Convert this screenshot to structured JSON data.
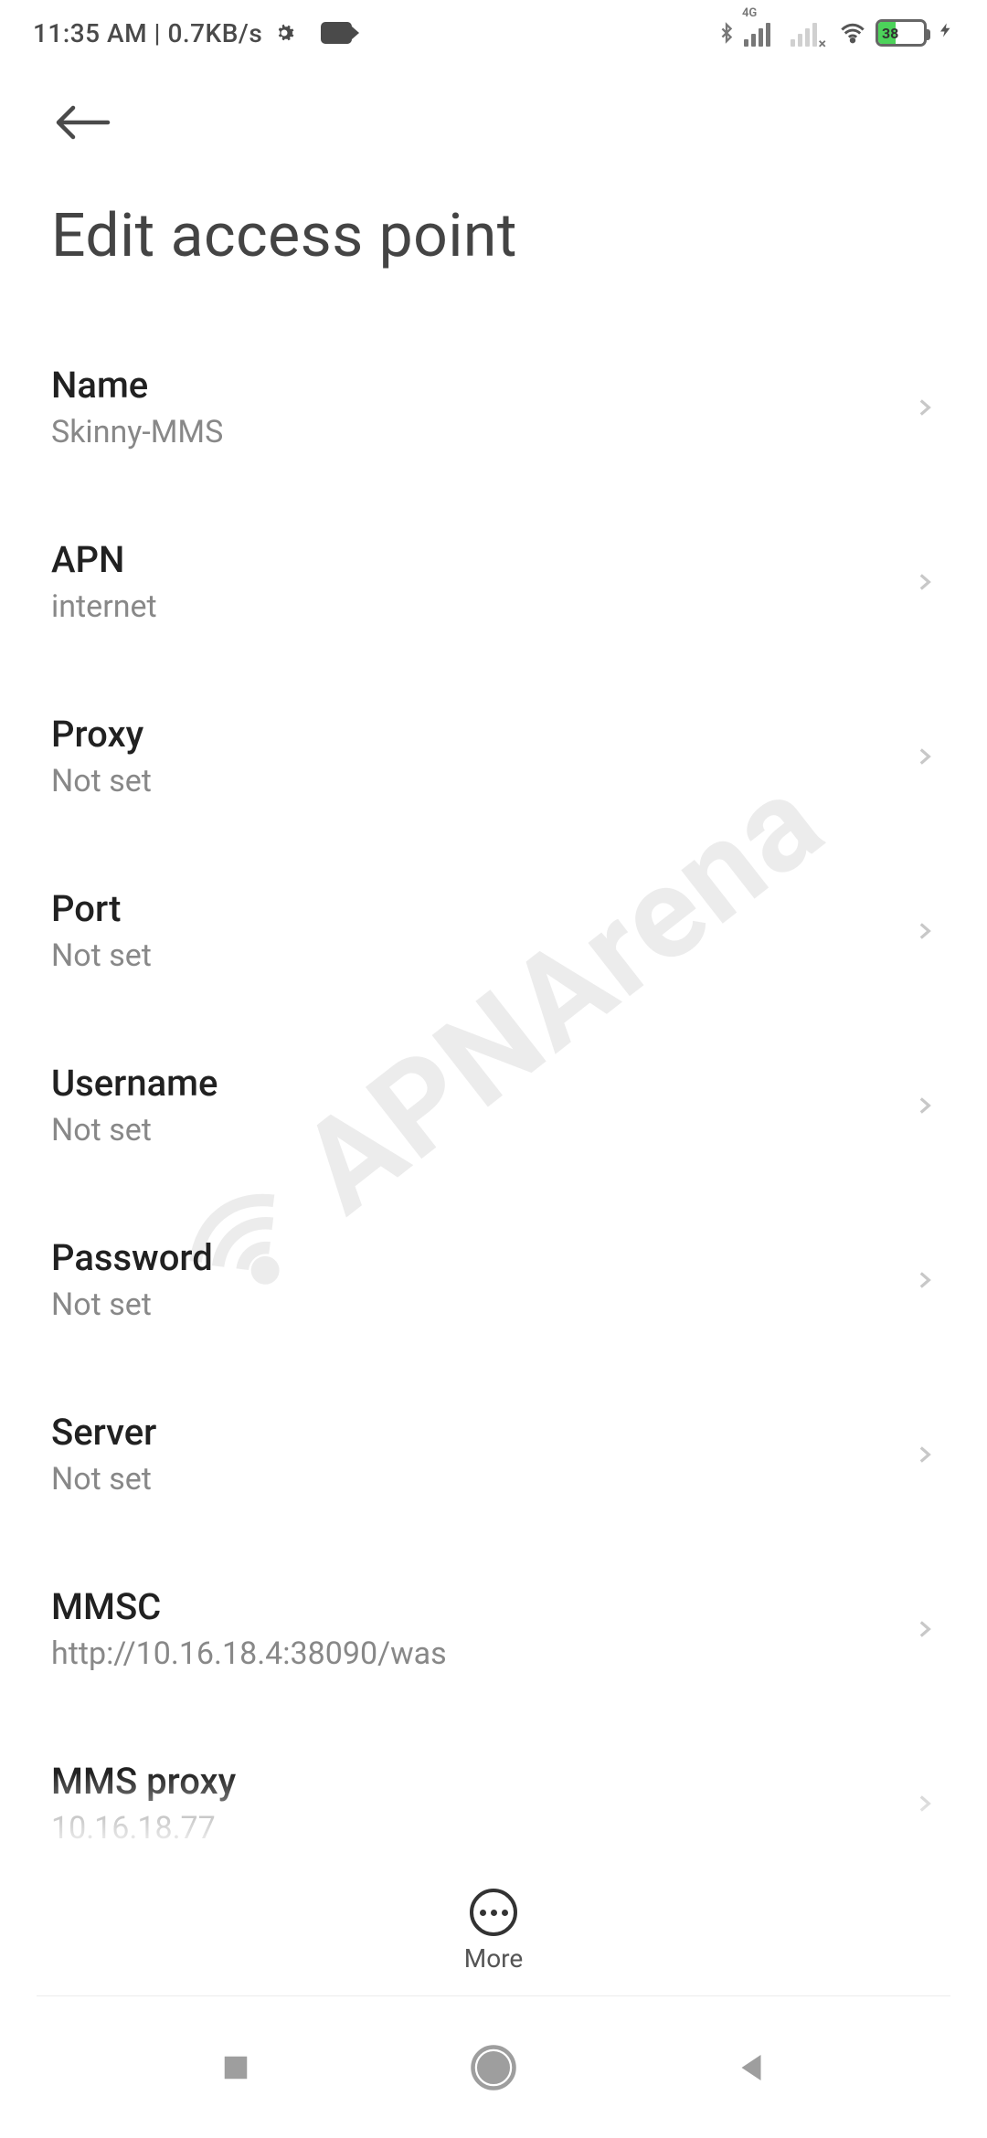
{
  "status_bar": {
    "time": "11:35 AM",
    "speed": "0.7KB/s",
    "signal_label": "4G",
    "battery_percent": "38"
  },
  "page_title": "Edit access point",
  "settings": [
    {
      "label": "Name",
      "value": "Skinny-MMS"
    },
    {
      "label": "APN",
      "value": "internet"
    },
    {
      "label": "Proxy",
      "value": "Not set"
    },
    {
      "label": "Port",
      "value": "Not set"
    },
    {
      "label": "Username",
      "value": "Not set"
    },
    {
      "label": "Password",
      "value": "Not set"
    },
    {
      "label": "Server",
      "value": "Not set"
    },
    {
      "label": "MMSC",
      "value": "http://10.16.18.4:38090/was"
    },
    {
      "label": "MMS proxy",
      "value": "10.16.18.77"
    }
  ],
  "more_label": "More",
  "watermark_text": "APNArena"
}
